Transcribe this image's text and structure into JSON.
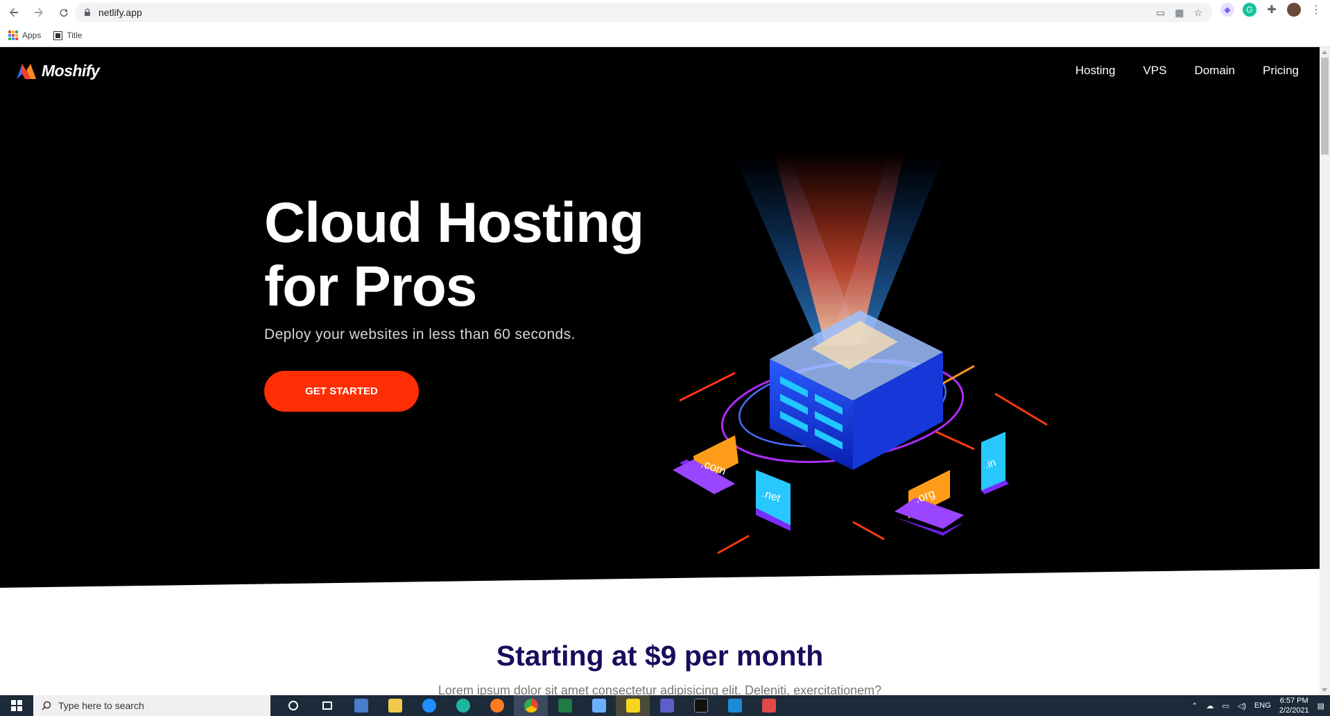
{
  "browser": {
    "url": "netlify.app",
    "bookmarks": [
      "Apps",
      "Title"
    ]
  },
  "site": {
    "brand": "Moshify",
    "nav": [
      "Hosting",
      "VPS",
      "Domain",
      "Pricing"
    ],
    "hero": {
      "title_line1": "Cloud Hosting",
      "title_line2": "for Pros",
      "subtitle": "Deploy your websites in less than 60 seconds.",
      "cta": "GET STARTED"
    },
    "illustration": {
      "labels": [
        ".com",
        ".net",
        ".org",
        ".in"
      ]
    },
    "pricing": {
      "title": "Starting at $9 per month",
      "subtitle": "Lorem ipsum dolor sit amet consectetur adipisicing elit. Deleniti, exercitationem?"
    }
  },
  "taskbar": {
    "search_placeholder": "Type here to search",
    "language": "ENG",
    "time": "6:57 PM",
    "date": "2/2/2021"
  },
  "colors": {
    "accent": "#ff2e05",
    "heading": "#1a0c5c",
    "hero_bg": "#000000"
  }
}
